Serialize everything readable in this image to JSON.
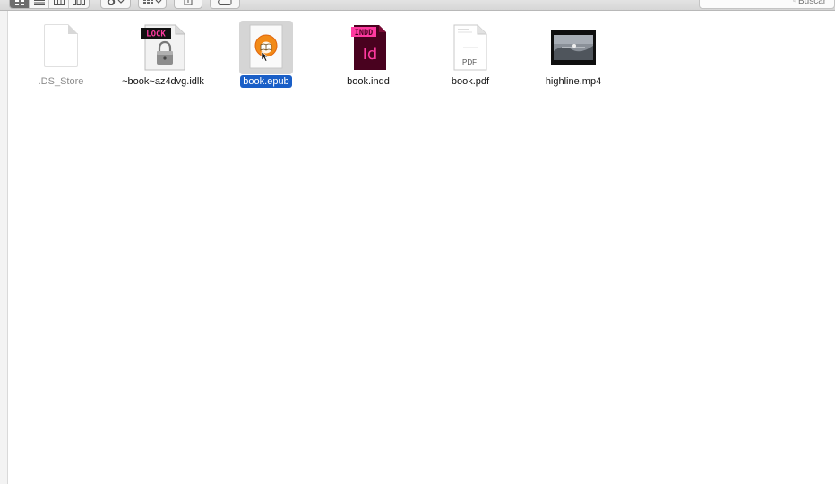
{
  "toolbar": {
    "view_buttons": [
      "icon-view",
      "list-view",
      "column-view",
      "cover-flow-view"
    ],
    "action_icon": "gear-icon",
    "arrange_icon": "grid-icon",
    "share_icon": "share-icon",
    "tags_icon": "tag-icon",
    "search": {
      "placeholder": "Buscar",
      "value": ""
    }
  },
  "files": [
    {
      "name": ".DS_Store",
      "icon": "blank-document-icon",
      "dimmed": true,
      "selected": false
    },
    {
      "name": "~book~az4dvg.idlk",
      "icon": "lock-file-icon",
      "badge": "LOCK",
      "dimmed": false,
      "selected": false
    },
    {
      "name": "book.epub",
      "icon": "ibooks-epub-icon",
      "dimmed": false,
      "selected": true
    },
    {
      "name": "book.indd",
      "icon": "indesign-document-icon",
      "badge": "INDD",
      "glyph": "Id",
      "dimmed": false,
      "selected": false
    },
    {
      "name": "book.pdf",
      "icon": "pdf-document-icon",
      "badge": "PDF",
      "dimmed": false,
      "selected": false
    },
    {
      "name": "highline.mp4",
      "icon": "video-thumbnail-icon",
      "dimmed": false,
      "selected": false
    }
  ],
  "colors": {
    "selection": "#1a5fc7",
    "indesign_magenta": "#ff3aa0",
    "indesign_dark": "#49021f",
    "ibooks_orange": "#f28a17"
  }
}
